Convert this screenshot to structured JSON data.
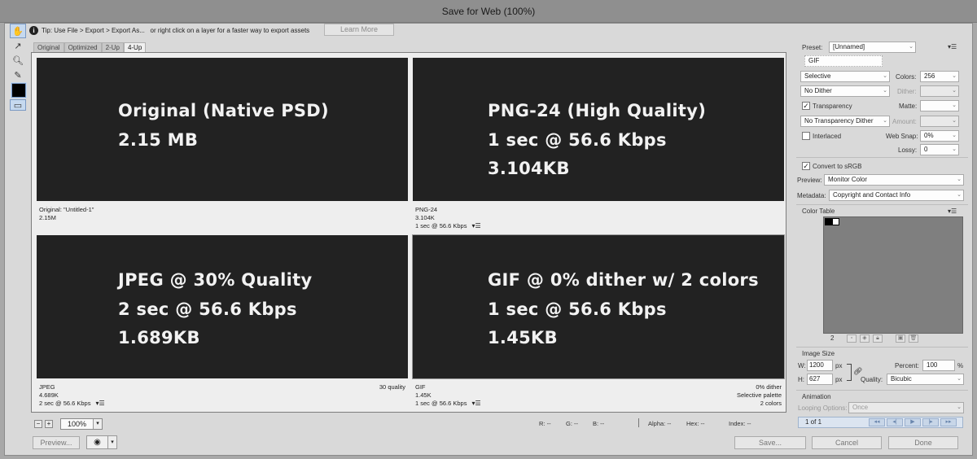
{
  "window": {
    "title": "Save for Web (100%)"
  },
  "tip": {
    "text": "Tip: Use File > Export > Export As...   or right click on a layer for a faster way to export assets",
    "learn_more": "Learn More"
  },
  "view_tabs": [
    "Original",
    "Optimized",
    "2-Up",
    "4-Up"
  ],
  "active_tab": "4-Up",
  "panes": [
    {
      "overlay": [
        "Original (Native PSD)",
        "2.15 MB"
      ],
      "caption_left": [
        "Original: \"Untitled-1\"",
        "2.15M"
      ],
      "caption_right": []
    },
    {
      "overlay": [
        "PNG-24 (High Quality)",
        "1 sec @ 56.6 Kbps",
        "3.104KB"
      ],
      "caption_left": [
        "PNG-24",
        "3.104K",
        "1 sec @ 56.6 Kbps"
      ],
      "caption_right": []
    },
    {
      "overlay": [
        "JPEG @ 30% Quality",
        "2 sec @ 56.6 Kbps",
        "1.689KB"
      ],
      "caption_left": [
        "JPEG",
        "4.689K",
        "2 sec @ 56.6 Kbps"
      ],
      "caption_right": [
        "30 quality"
      ]
    },
    {
      "overlay": [
        "GIF @ 0% dither w/ 2 colors",
        "1 sec @ 56.6 Kbps",
        "1.45KB"
      ],
      "caption_left": [
        "GIF",
        "1.45K",
        "1 sec @ 56.6 Kbps"
      ],
      "caption_right": [
        "0% dither",
        "Selective palette",
        "2 colors"
      ]
    }
  ],
  "zoom": "100%",
  "readout": {
    "r": "R: --",
    "g": "G: --",
    "b": "B: --",
    "alpha": "Alpha: --",
    "hex": "Hex: --",
    "index": "Index: --"
  },
  "buttons": {
    "preview": "Preview...",
    "save": "Save...",
    "cancel": "Cancel",
    "done": "Done"
  },
  "settings": {
    "preset_label": "Preset:",
    "preset_value": "[Unnamed]",
    "format": "GIF",
    "reduction": "Selective",
    "colors_label": "Colors:",
    "colors_value": "256",
    "dither_algo": "No Dither",
    "dither_label": "Dither:",
    "transparency_label": "Transparency",
    "transparency_checked": true,
    "matte_label": "Matte:",
    "transparency_dither": "No Transparency Dither",
    "amount_label": "Amount:",
    "interlaced_label": "Interlaced",
    "interlaced_checked": false,
    "websnap_label": "Web Snap:",
    "websnap_value": "0%",
    "lossy_label": "Lossy:",
    "lossy_value": "0",
    "srgb_label": "Convert to sRGB",
    "srgb_checked": true,
    "preview_label": "Preview:",
    "preview_value": "Monitor Color",
    "metadata_label": "Metadata:",
    "metadata_value": "Copyright and Contact Info"
  },
  "color_table": {
    "title": "Color Table",
    "count": "2",
    "swatches": [
      "#000000",
      "#ffffff"
    ]
  },
  "image_size": {
    "title": "Image Size",
    "w_label": "W:",
    "w_value": "1200",
    "w_unit": "px",
    "h_label": "H:",
    "h_value": "627",
    "h_unit": "px",
    "percent_label": "Percent:",
    "percent_value": "100",
    "percent_unit": "%",
    "quality_label": "Quality:",
    "quality_value": "Bicubic"
  },
  "animation": {
    "title": "Animation",
    "looping_label": "Looping Options:",
    "looping_value": "Once",
    "frame": "1 of 1"
  },
  "colors": {
    "pane_bg": "#222222",
    "accent": "#c6d9ef"
  }
}
